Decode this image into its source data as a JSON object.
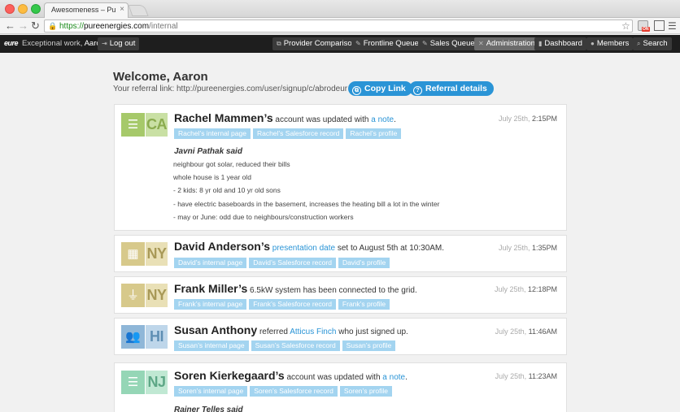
{
  "browser": {
    "tab_title": "Awesomeness – Pure Ener",
    "tab_close": "×",
    "url_scheme": "https://",
    "url_domain": "pureenergies.com",
    "url_path": "/internal",
    "badge": "ON"
  },
  "appbar": {
    "brand": "eure",
    "greeting_prefix": "Exceptional work, ",
    "greeting_name": "Aaron!",
    "logout": "Log out",
    "nav": [
      {
        "label": "Provider Comparison",
        "icon": "sitemap-icon"
      },
      {
        "label": "Frontline Queue",
        "icon": "pencil-icon"
      },
      {
        "label": "Sales Queue",
        "icon": "pencil-icon"
      },
      {
        "label": "Administration",
        "icon": "wrench-icon",
        "active": true
      },
      {
        "label": "Dashboard",
        "icon": "bar-chart-icon"
      },
      {
        "label": "Members",
        "icon": "user-icon"
      },
      {
        "label": "Search",
        "icon": "search-icon"
      }
    ]
  },
  "welcome": {
    "title": "Welcome, Aaron",
    "referral_text": "Your referral link: http://pureenergies.com/user/signup/c/abrodeur",
    "copy_link": "Copy Link",
    "referral_details": "Referral details"
  },
  "feed": [
    {
      "state": "CA",
      "name": "Rachel Mammen’s",
      "pre": "account was updated with",
      "link": "a note",
      "post": ".",
      "date": "July 25th, ",
      "time": "2:15PM",
      "tags": [
        "Rachel’s internal page",
        "Rachel’s Salesforce record",
        "Rachel’s profile"
      ],
      "note": {
        "author": "Javni Pathak said",
        "lines": [
          "neighbour got solar, reduced their bills",
          "whole house is 1 year old",
          "- 2 kids: 8 yr old and 10 yr old sons",
          "- have electric baseboards in the basement, increases the heating bill a lot in the winter",
          "- may or June: odd due to neighbours/construction workers"
        ]
      }
    },
    {
      "state": "NY",
      "name": "David Anderson’s",
      "pre": "",
      "link": "presentation date",
      "post": "set to August 5th at 10:30AM.",
      "date": "July 25th, ",
      "time": "1:35PM",
      "tags": [
        "David’s internal page",
        "David’s Salesforce record",
        "David’s profile"
      ]
    },
    {
      "state": "NY",
      "name": "Frank Miller’s",
      "pre": "6.5kW system has been connected to the grid.",
      "link": "",
      "post": "",
      "date": "July 25th, ",
      "time": "12:18PM",
      "tags": [
        "Frank’s internal page",
        "Frank’s Salesforce record",
        "Frank’s profile"
      ]
    },
    {
      "state": "HI",
      "name": "Susan Anthony",
      "pre": "referred",
      "link": "Atticus Finch",
      "post": "who just signed up.",
      "date": "July 25th, ",
      "time": "11:46AM",
      "tags": [
        "Susan’s internal page",
        "Susan’s Salesforce record",
        "Susan’s profile"
      ]
    },
    {
      "state": "NJ",
      "name": "Soren Kierkegaard’s",
      "pre": "account was updated with",
      "link": "a note",
      "post": ".",
      "date": "July 25th, ",
      "time": "11:23AM",
      "tags": [
        "Soren’s internal page",
        "Soren’s Salesforce record",
        "Soren’s profile"
      ],
      "note": {
        "author": "Rainer Telles said",
        "lines": []
      }
    }
  ]
}
